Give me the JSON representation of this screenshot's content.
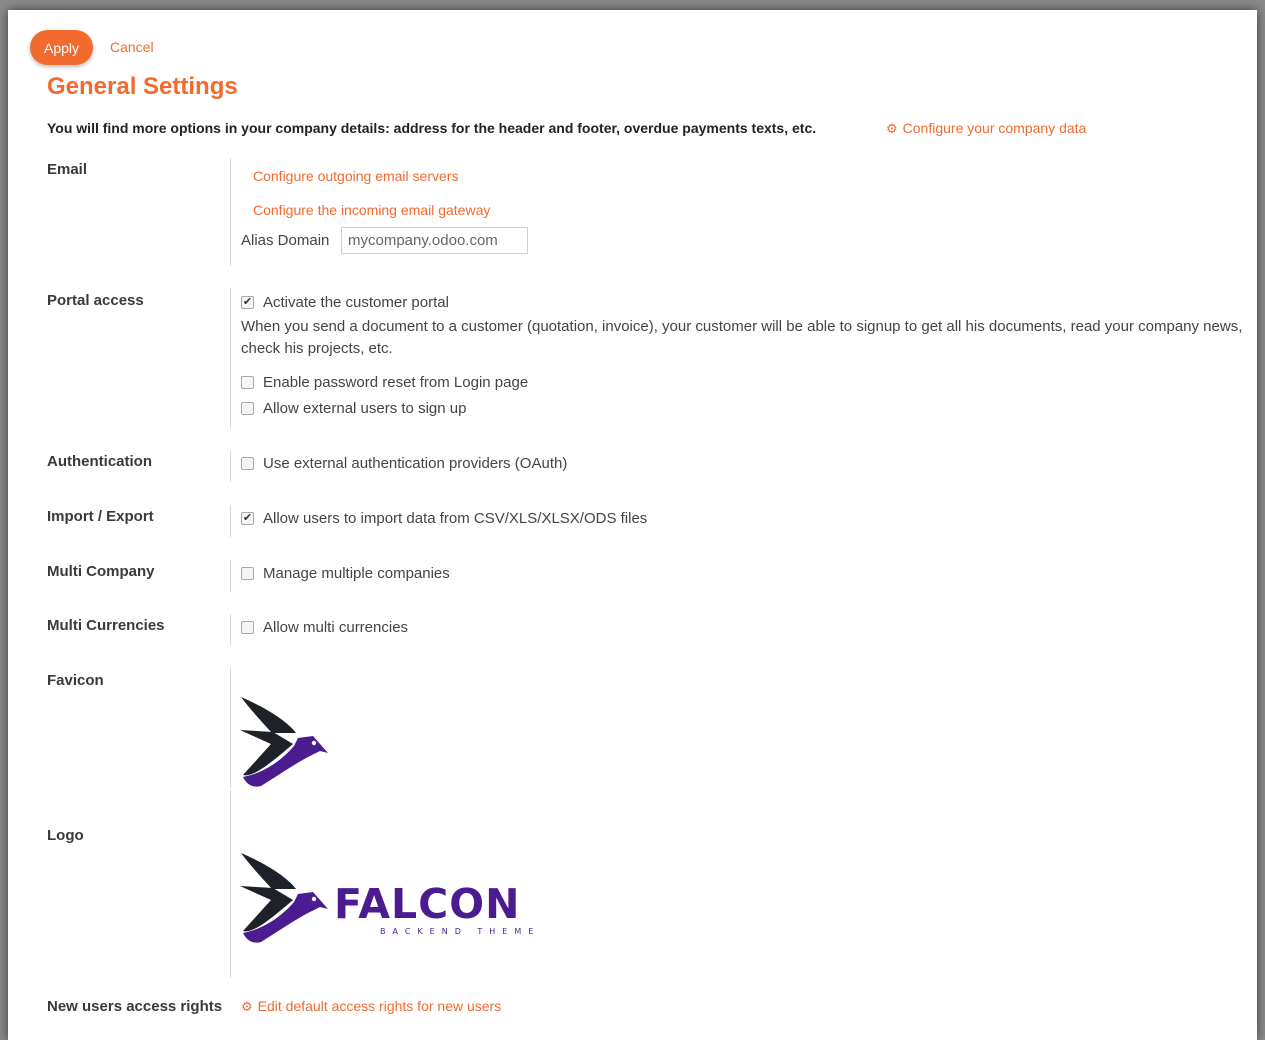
{
  "toolbar": {
    "apply_label": "Apply",
    "cancel_label": "Cancel"
  },
  "page": {
    "title": "General Settings",
    "intro": "You will find more options in your company details: address for the header and footer, overdue payments texts, etc.",
    "company_link": "Configure your company data"
  },
  "email": {
    "label": "Email",
    "outgoing_link": "Configure outgoing email servers",
    "incoming_link": "Configure the incoming email gateway",
    "alias_label": "Alias Domain",
    "alias_value": "mycompany.odoo.com"
  },
  "portal": {
    "label": "Portal access",
    "activate": {
      "text": "Activate the customer portal",
      "checked": true
    },
    "description": "When you send a document to a customer (quotation, invoice), your customer will be able to signup to get all his documents, read your company news, check his projects, etc.",
    "password_reset": {
      "text": "Enable password reset from Login page",
      "checked": false
    },
    "external_signup": {
      "text": "Allow external users to sign up",
      "checked": false
    }
  },
  "authentication": {
    "label": "Authentication",
    "text": "Use external authentication providers (OAuth)",
    "checked": false
  },
  "import_export": {
    "label": "Import / Export",
    "text": "Allow users to import data from CSV/XLS/XLSX/ODS files",
    "checked": true
  },
  "multi_company": {
    "label": "Multi Company",
    "text": "Manage multiple companies",
    "checked": false
  },
  "multi_currencies": {
    "label": "Multi Currencies",
    "text": "Allow multi currencies",
    "checked": false
  },
  "favicon": {
    "label": "Favicon"
  },
  "logo": {
    "label": "Logo",
    "brand": "FALCON",
    "tagline": "BACKEND THEME"
  },
  "access_rights": {
    "label": "New users access rights",
    "link": "Edit default access rights for new users"
  },
  "colors": {
    "accent": "#f26a2e",
    "falcon_dark": "#1e2127",
    "falcon_purple": "#4b1c8f"
  },
  "icons": {
    "gears": "gears-icon",
    "check": "check-icon"
  }
}
